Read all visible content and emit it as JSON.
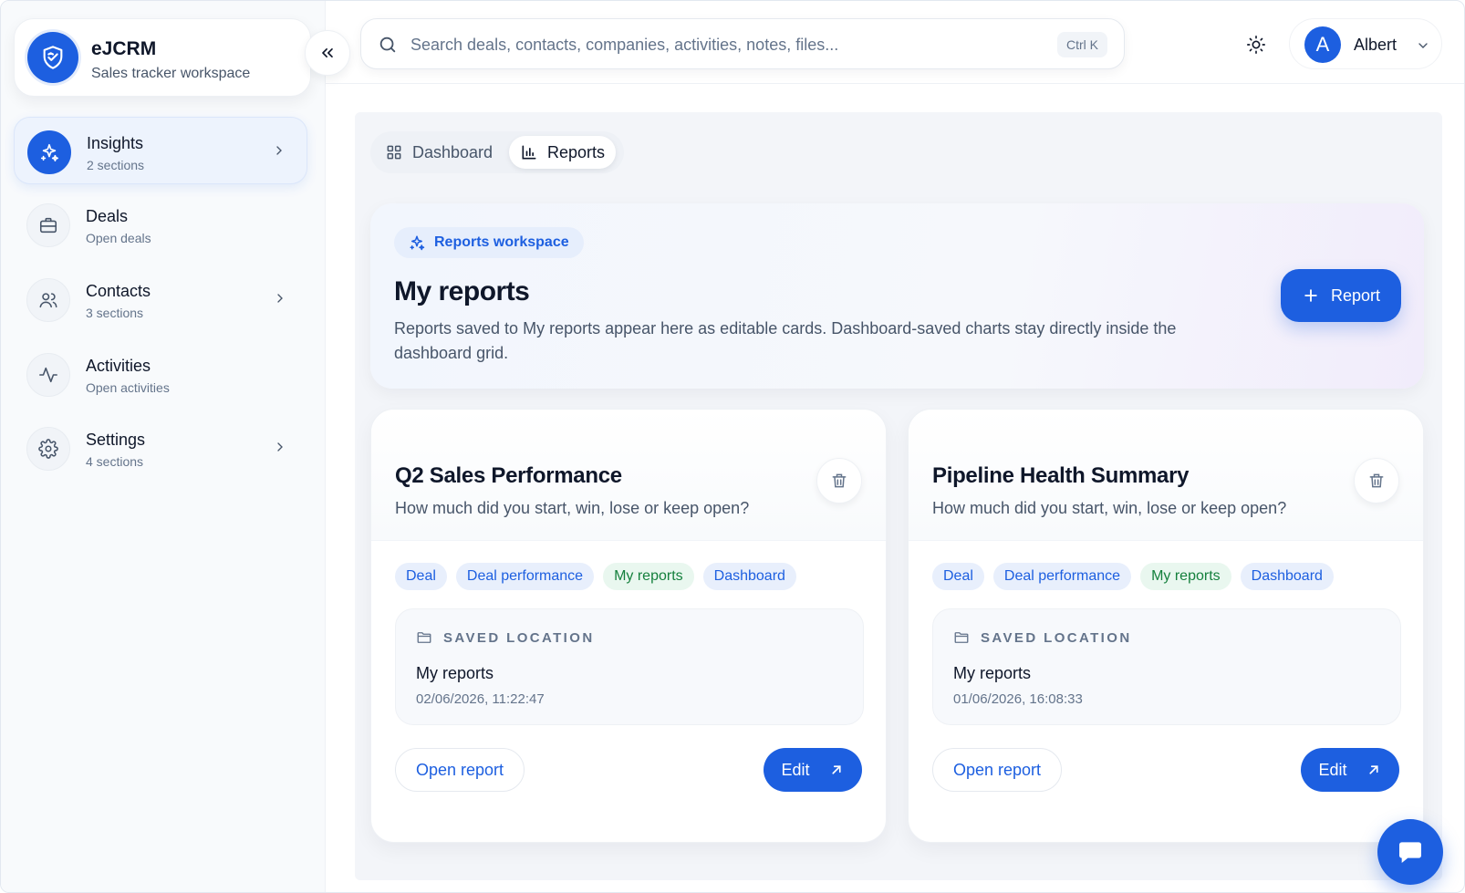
{
  "brand": {
    "title": "eJCRM",
    "subtitle": "Sales tracker workspace"
  },
  "sidebar": {
    "items": [
      {
        "label": "Insights",
        "sub": "2 sections"
      },
      {
        "label": "Deals",
        "sub": "Open deals"
      },
      {
        "label": "Contacts",
        "sub": "3 sections"
      },
      {
        "label": "Activities",
        "sub": "Open activities"
      },
      {
        "label": "Settings",
        "sub": "4 sections"
      }
    ]
  },
  "search": {
    "placeholder": "Search deals, contacts, companies, activities, notes, files...",
    "shortcut": "Ctrl K"
  },
  "user": {
    "initial": "A",
    "name": "Albert"
  },
  "tabs": [
    {
      "label": "Dashboard"
    },
    {
      "label": "Reports"
    }
  ],
  "hero": {
    "chip": "Reports workspace",
    "title": "My reports",
    "description": "Reports saved to My reports appear here as editable cards. Dashboard-saved charts stay directly inside the dashboard grid.",
    "button": "Report"
  },
  "cards": [
    {
      "title": "Q2 Sales Performance",
      "desc": "How much did you start, win, lose or keep open?",
      "tags": [
        "Deal",
        "Deal performance",
        "My reports",
        "Dashboard"
      ],
      "loc_heading": "SAVED LOCATION",
      "loc_name": "My reports",
      "loc_time": "02/06/2026, 11:22:47",
      "open": "Open report",
      "edit": "Edit"
    },
    {
      "title": "Pipeline Health Summary",
      "desc": "How much did you start, win, lose or keep open?",
      "tags": [
        "Deal",
        "Deal performance",
        "My reports",
        "Dashboard"
      ],
      "loc_heading": "SAVED LOCATION",
      "loc_name": "My reports",
      "loc_time": "01/06/2026, 16:08:33",
      "open": "Open report",
      "edit": "Edit"
    }
  ],
  "colors": {
    "accent": "#1d5fe0",
    "tag_green": "#15803d"
  }
}
